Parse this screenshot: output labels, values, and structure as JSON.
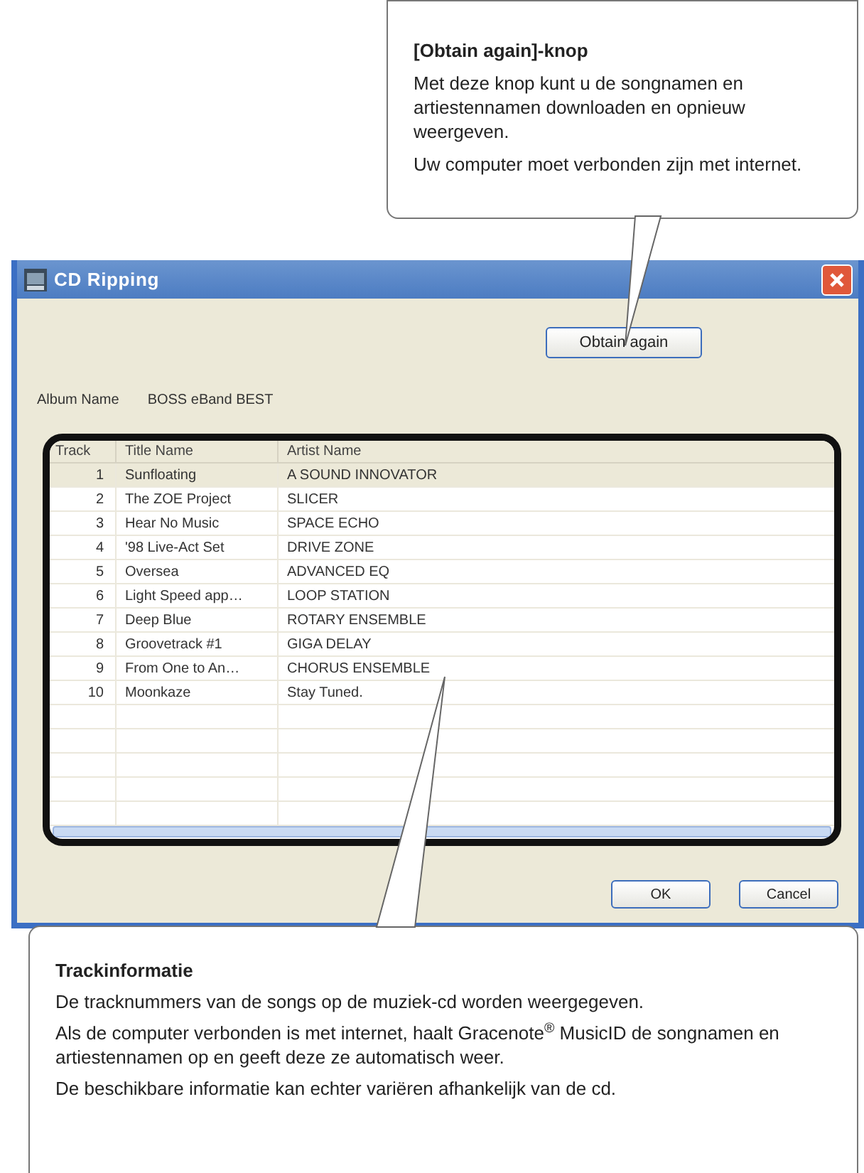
{
  "callouts": [
    {
      "title": "[Obtain again]-knop",
      "paragraphs": [
        "Met deze knop kunt u de songnamen en artiestennamen downloaden en opnieuw weergeven.",
        "Uw computer moet verbonden zijn met internet."
      ]
    },
    {
      "title": "Trackinformatie",
      "paragraphs": [
        "De tracknummers van de songs op de muziek-cd worden weergegeven.",
        "Als de computer verbonden is met internet, haalt Gracenote$^{®}$ MusicID de songnamen en artiestennamen op en geeft deze ze automatisch weer.",
        "De beschikbare informatie kan echter variëren afhankelijk van de cd."
      ]
    }
  ],
  "window": {
    "title": "CD Ripping"
  },
  "obtain_button": "Obtain again",
  "album": {
    "label": "Album Name",
    "value": "BOSS eBand BEST"
  },
  "table": {
    "columns": [
      "Track",
      "Title Name",
      "Artist Name"
    ],
    "rows": [
      {
        "track": "1",
        "title": "Sunfloating",
        "artist": "A SOUND INNOVATOR",
        "selected": true
      },
      {
        "track": "2",
        "title": "The ZOE Project",
        "artist": "SLICER",
        "selected": false
      },
      {
        "track": "3",
        "title": "Hear No Music",
        "artist": "SPACE ECHO",
        "selected": false
      },
      {
        "track": "4",
        "title": "'98 Live-Act Set",
        "artist": "DRIVE ZONE",
        "selected": false
      },
      {
        "track": "5",
        "title": "Oversea",
        "artist": "ADVANCED EQ",
        "selected": false
      },
      {
        "track": "6",
        "title": "Light Speed app…",
        "artist": "LOOP STATION",
        "selected": false
      },
      {
        "track": "7",
        "title": "Deep Blue",
        "artist": "ROTARY ENSEMBLE",
        "selected": false
      },
      {
        "track": "8",
        "title": "Groovetrack #1",
        "artist": "GIGA DELAY",
        "selected": false
      },
      {
        "track": "9",
        "title": "From One to An…",
        "artist": "CHORUS ENSEMBLE",
        "selected": false
      },
      {
        "track": "10",
        "title": "Moonkaze",
        "artist": "Stay Tuned.",
        "selected": false
      }
    ]
  },
  "buttons": [
    "OK",
    "Cancel"
  ]
}
